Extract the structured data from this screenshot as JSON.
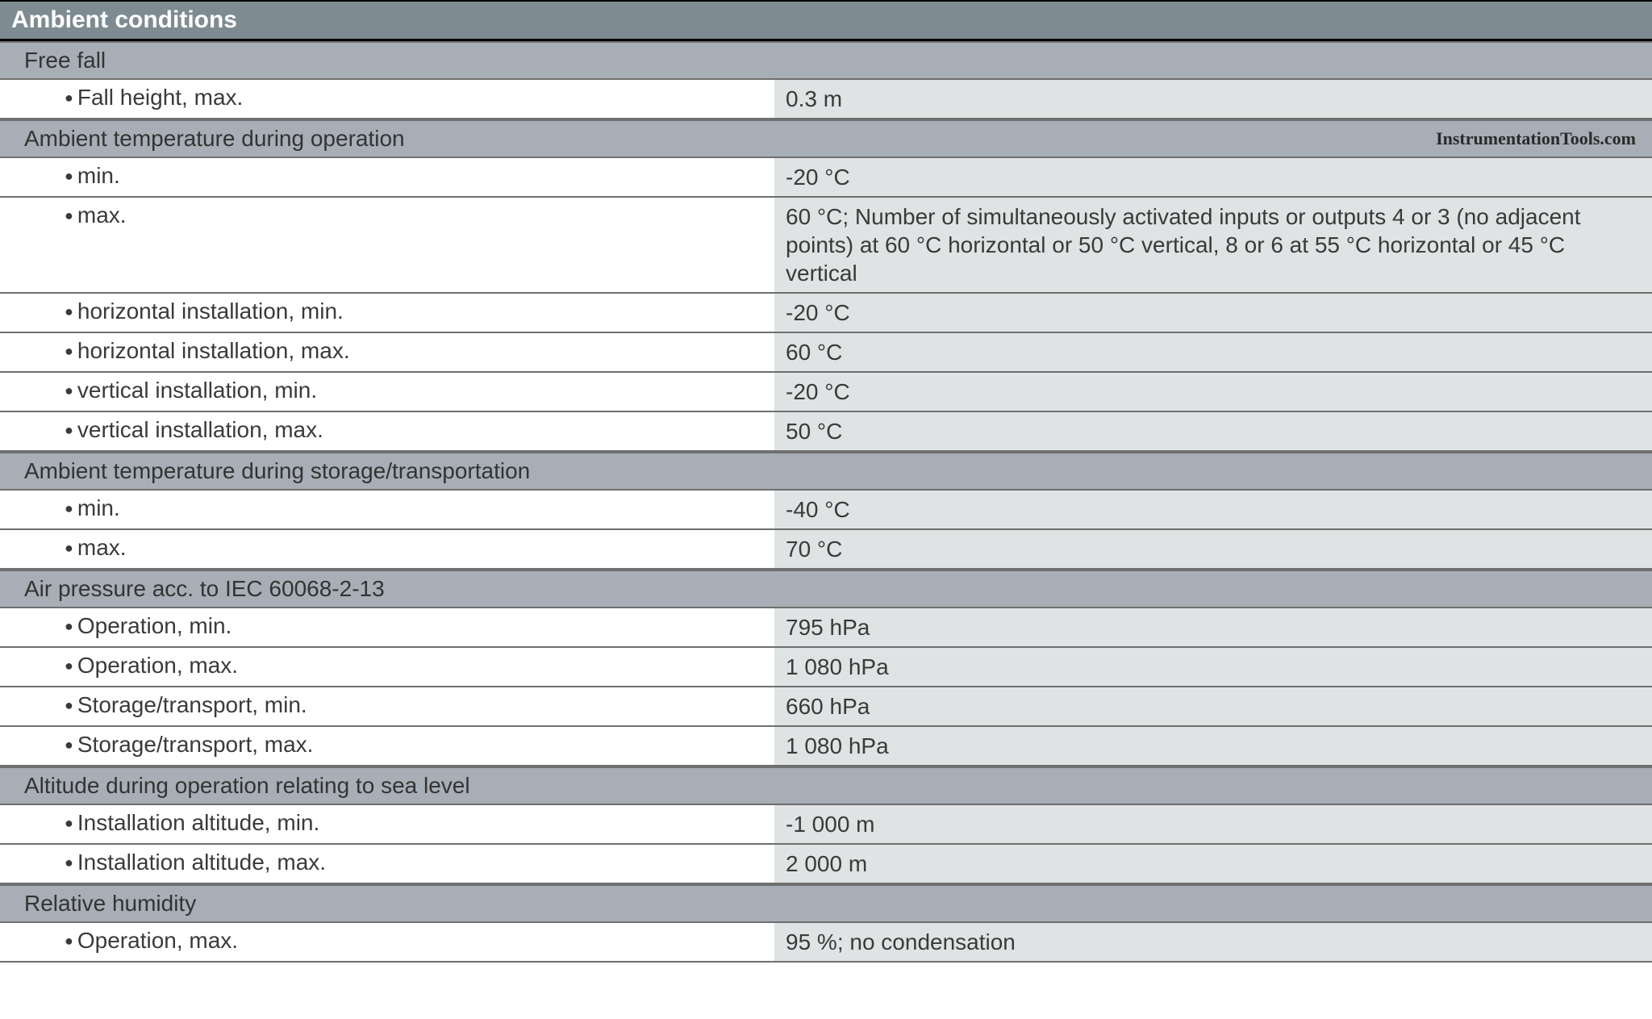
{
  "section_title": "Ambient conditions",
  "watermark": "InstrumentationTools.com",
  "groups": [
    {
      "heading": "Free fall",
      "rows": [
        {
          "label": "Fall height, max.",
          "value": "0.3 m"
        }
      ]
    },
    {
      "heading": "Ambient temperature during operation",
      "has_watermark": true,
      "rows": [
        {
          "label": "min.",
          "value": "-20 °C"
        },
        {
          "label": "max.",
          "value": "60 °C; Number of simultaneously activated inputs or outputs 4 or 3 (no adjacent points) at 60 °C horizontal or 50 °C vertical, 8 or 6 at 55 °C horizontal or 45 °C vertical"
        },
        {
          "label": "horizontal installation, min.",
          "value": "-20 °C"
        },
        {
          "label": "horizontal installation, max.",
          "value": "60 °C"
        },
        {
          "label": "vertical installation, min.",
          "value": "-20 °C"
        },
        {
          "label": "vertical installation, max.",
          "value": "50 °C"
        }
      ]
    },
    {
      "heading": "Ambient temperature during storage/transportation",
      "rows": [
        {
          "label": "min.",
          "value": "-40 °C"
        },
        {
          "label": "max.",
          "value": "70 °C"
        }
      ]
    },
    {
      "heading": "Air pressure acc. to IEC 60068-2-13",
      "rows": [
        {
          "label": "Operation, min.",
          "value": "795 hPa"
        },
        {
          "label": "Operation, max.",
          "value": "1 080 hPa"
        },
        {
          "label": "Storage/transport, min.",
          "value": "660 hPa"
        },
        {
          "label": "Storage/transport, max.",
          "value": "1 080 hPa"
        }
      ]
    },
    {
      "heading": "Altitude during operation relating to sea level",
      "rows": [
        {
          "label": "Installation altitude, min.",
          "value": "-1 000 m"
        },
        {
          "label": "Installation altitude, max.",
          "value": "2 000 m"
        }
      ]
    },
    {
      "heading": "Relative humidity",
      "rows": [
        {
          "label": "Operation, max.",
          "value": "95 %; no condensation"
        }
      ]
    }
  ]
}
